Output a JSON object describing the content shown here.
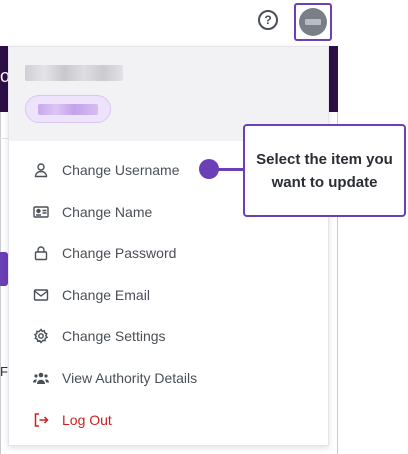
{
  "topbar": {
    "help_icon": "question-circle-icon",
    "help_glyph": "?",
    "avatar_icon": "user-avatar"
  },
  "background": {
    "partial_letter_1": "o",
    "partial_letter_2": "F"
  },
  "dropdown": {
    "user_name": "",
    "user_role": "",
    "items": [
      {
        "label": "Change Username",
        "icon": "user-icon"
      },
      {
        "label": "Change Name",
        "icon": "id-card-icon"
      },
      {
        "label": "Change Password",
        "icon": "lock-icon"
      },
      {
        "label": "Change Email",
        "icon": "envelope-icon"
      },
      {
        "label": "Change Settings",
        "icon": "gear-icon"
      },
      {
        "label": "View Authority Details",
        "icon": "users-icon"
      },
      {
        "label": "Log Out",
        "icon": "logout-icon"
      }
    ]
  },
  "callout": {
    "text": "Select the item you want to update",
    "accent_color": "#6b3fb5"
  },
  "colors": {
    "accent": "#6b3fb5",
    "header_dark": "#2b0f45",
    "logout_red": "#d11f1f"
  }
}
